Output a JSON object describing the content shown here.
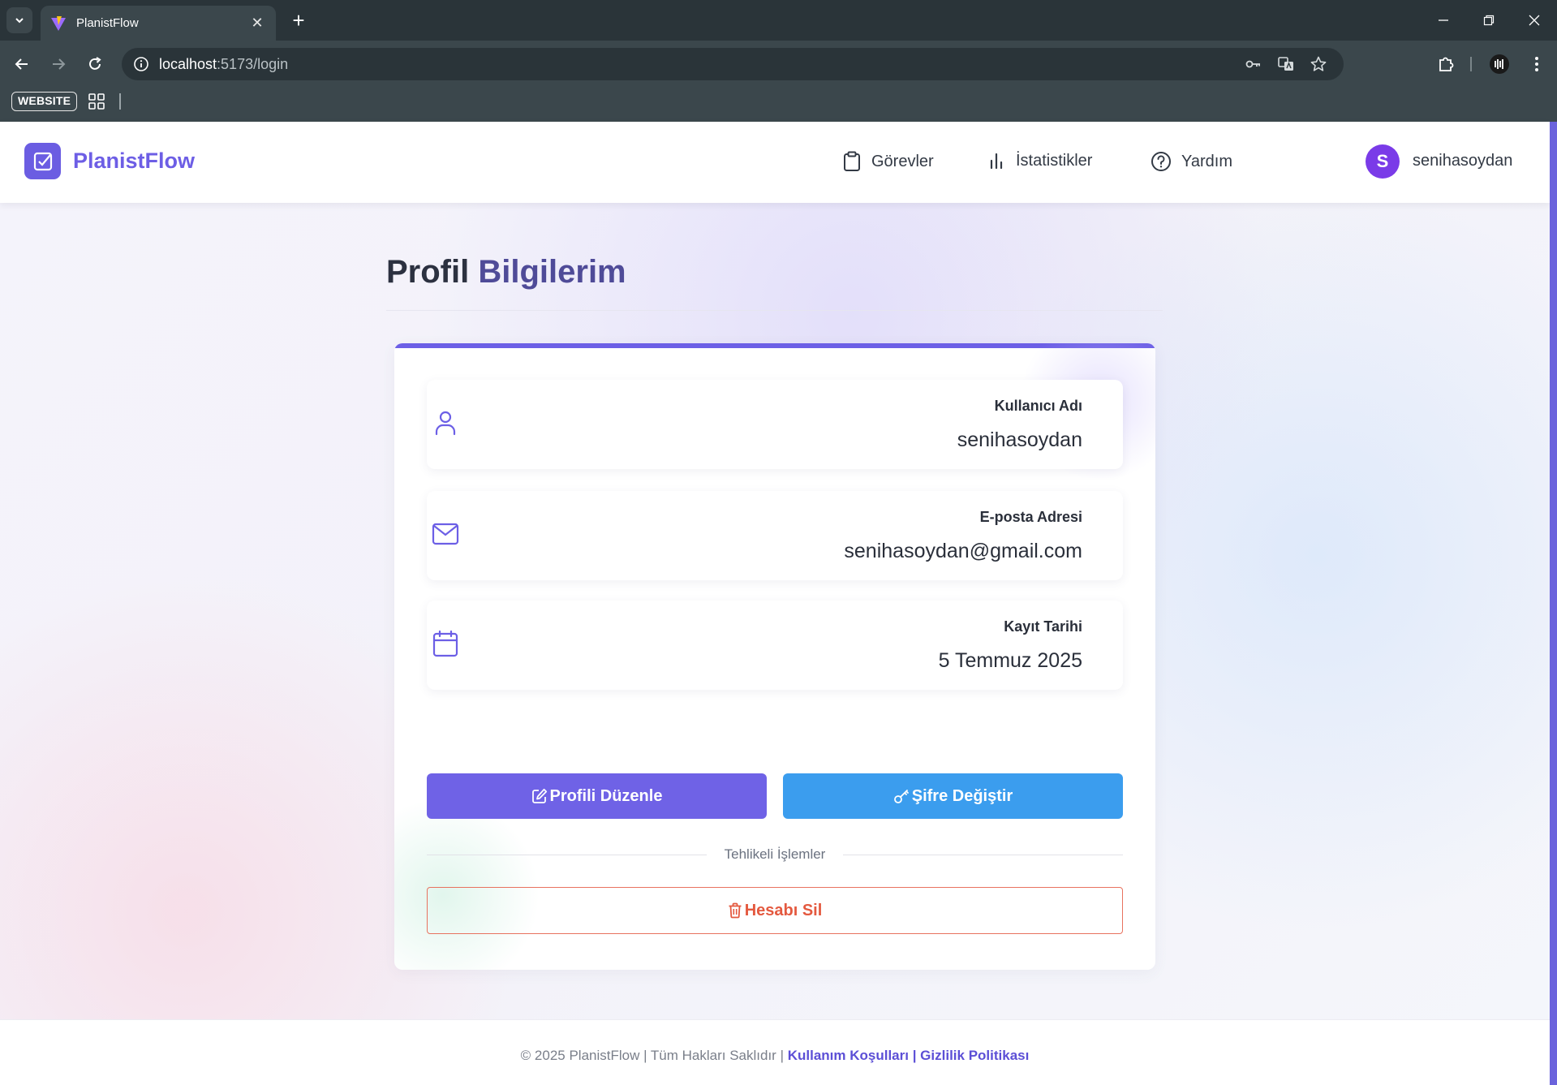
{
  "browser": {
    "tab_title": "PlanistFlow",
    "url_host": "localhost",
    "url_path": ":5173/login",
    "bookmark_label": "WEBSITE"
  },
  "app": {
    "brand": "PlanistFlow",
    "nav": [
      {
        "label": "Görevler",
        "icon": "clipboard-icon"
      },
      {
        "label": "İstatistikler",
        "icon": "bar-chart-icon"
      },
      {
        "label": "Yardım",
        "icon": "help-circle-icon"
      }
    ],
    "user": {
      "initial": "S",
      "name": "senihasoydan"
    }
  },
  "profile": {
    "title_main": "Profil",
    "title_accent": "Bilgilerim",
    "fields": [
      {
        "label": "Kullanıcı Adı",
        "value": "senihasoydan",
        "icon": "user-icon"
      },
      {
        "label": "E-posta Adresi",
        "value": "senihasoydan@gmail.com",
        "icon": "mail-icon"
      },
      {
        "label": "Kayıt Tarihi",
        "value": "5 Temmuz 2025",
        "icon": "calendar-icon"
      }
    ],
    "edit_button": "Profili Düzenle",
    "password_button": "Şifre Değiştir",
    "danger_section": "Tehlikeli İşlemler",
    "delete_button": "Hesabı Sil"
  },
  "footer": {
    "copyright": "© 2025 PlanistFlow | Tüm Hakları Saklıdır | ",
    "terms": "Kullanım Koşulları",
    "separator": " | ",
    "privacy": "Gizlilik Politikası"
  },
  "colors": {
    "primary": "#6c5fe6",
    "secondary": "#3b9dee",
    "danger": "#e4593f",
    "avatar": "#7a3be8"
  }
}
